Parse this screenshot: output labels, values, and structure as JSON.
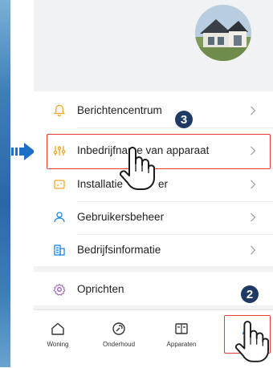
{
  "menu": {
    "items": [
      {
        "label": "Berichtencentrum",
        "icon": "bell-icon"
      },
      {
        "label": "Inbedrijfname van apparaat",
        "icon": "settings-sliders-icon"
      },
      {
        "label": "Installatiehandleiding",
        "display": "Installatie",
        "suffix": "er",
        "icon": "guide-icon"
      },
      {
        "label": "Gebruikersbeheer",
        "icon": "user-icon"
      },
      {
        "label": "Bedrijfsinformatie",
        "icon": "building-icon"
      }
    ],
    "extra": {
      "label": "Oprichten",
      "icon": "gear-icon"
    }
  },
  "tabs": [
    {
      "label": "Woning",
      "icon": "home-icon"
    },
    {
      "label": "Onderhoud",
      "icon": "maintenance-icon"
    },
    {
      "label": "Apparaten",
      "icon": "devices-icon"
    },
    {
      "label": "Mij",
      "display": "M",
      "icon": "person-icon"
    }
  ],
  "annotations": {
    "step_top": "3",
    "step_bottom": "2"
  },
  "colors": {
    "accent": "#e53935",
    "icon_blue": "#1e88e5",
    "icon_orange": "#f5a623",
    "badge": "#1f3a64",
    "arrow": "#1e6fc7"
  }
}
